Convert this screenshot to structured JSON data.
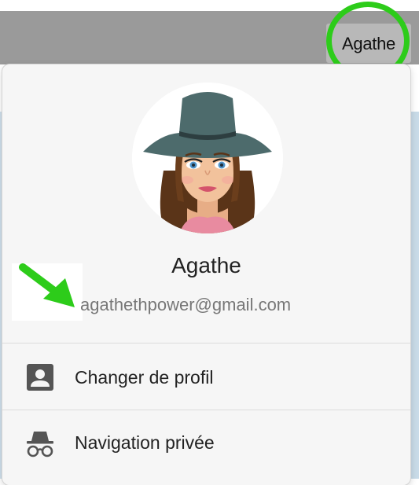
{
  "toolbar": {
    "profile_button_label": "Agathe"
  },
  "profile_menu": {
    "name": "Agathe",
    "email": "agathethpower@gmail.com",
    "items": [
      {
        "label": "Changer de profil",
        "icon": "switch-profile-icon"
      },
      {
        "label": "Navigation privée",
        "icon": "incognito-icon"
      }
    ]
  },
  "annotations": {
    "circle_color": "#2dcc1a",
    "arrow_color": "#2dcc1a"
  }
}
